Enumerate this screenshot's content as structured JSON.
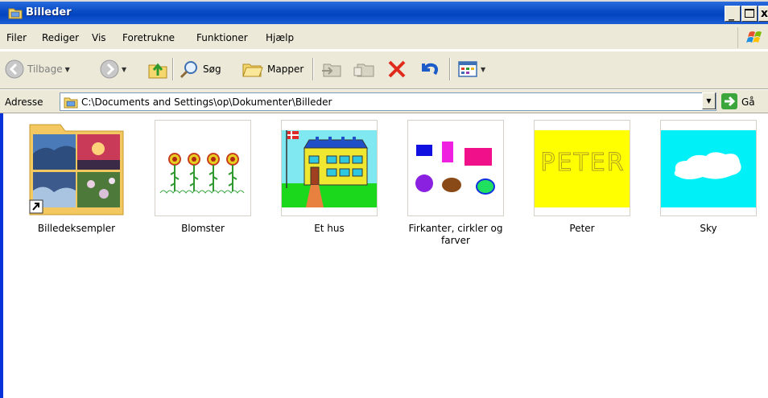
{
  "window": {
    "title": "Billeder"
  },
  "menu": [
    "Filer",
    "Rediger",
    "Vis",
    "Foretrukne",
    "Funktioner",
    "Hjælp"
  ],
  "toolbar": {
    "back_label": "Tilbage",
    "search_label": "Søg",
    "folders_label": "Mapper"
  },
  "address": {
    "label": "Adresse",
    "path": "C:\\Documents and Settings\\op\\Dokumenter\\Billeder",
    "go_label": "Gå"
  },
  "items": [
    {
      "name": "Billedeksempler",
      "icon": "folder-shortcut-icon"
    },
    {
      "name": "Blomster",
      "icon": "image-thumbnail"
    },
    {
      "name": "Et hus",
      "icon": "image-thumbnail"
    },
    {
      "name": "Firkanter, cirkler og farver",
      "icon": "image-thumbnail"
    },
    {
      "name": "Peter",
      "icon": "image-thumbnail",
      "thumb_text": "PETER"
    },
    {
      "name": "Sky",
      "icon": "image-thumbnail"
    }
  ]
}
